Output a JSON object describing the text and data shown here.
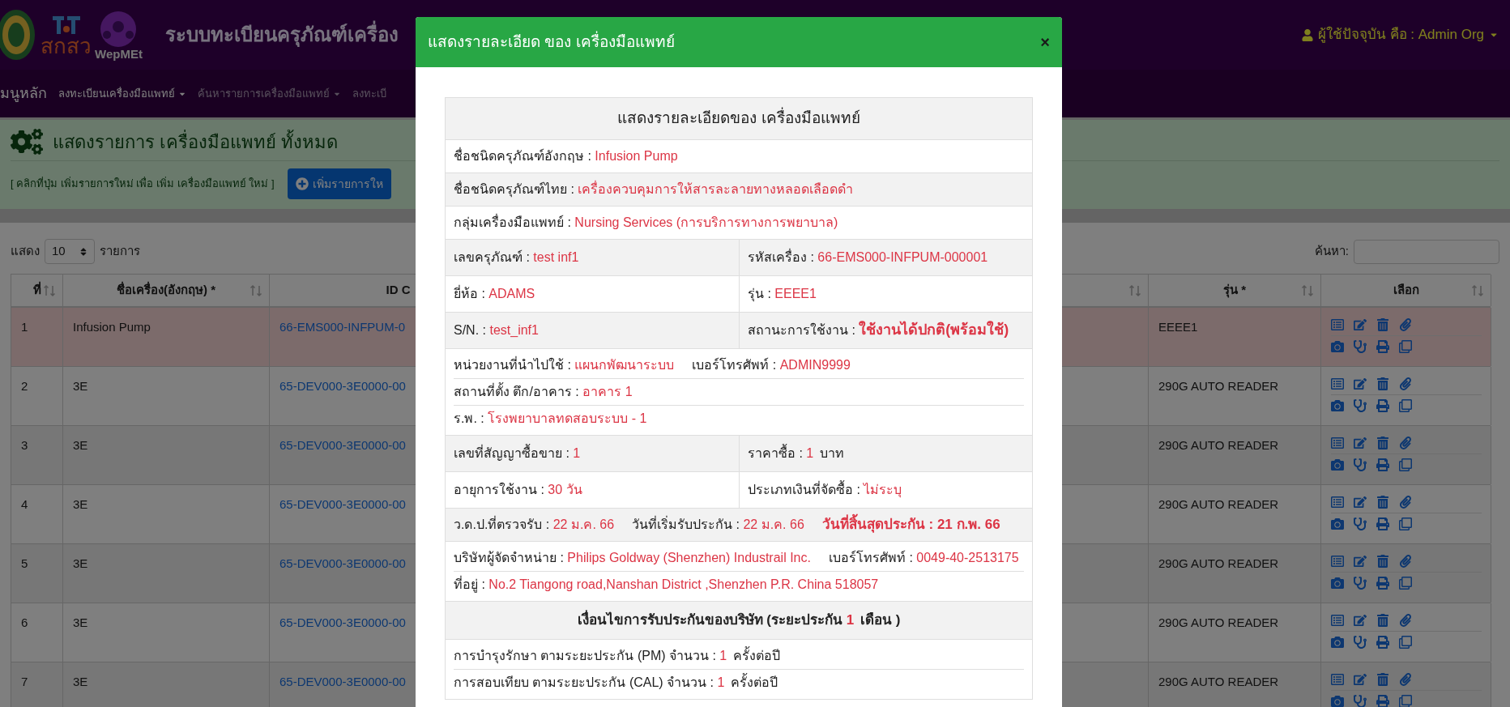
{
  "header": {
    "logo_texts": [
      "สกสว",
      "WepMEt"
    ],
    "title": "ระบบทะเบียนครุภัณฑ์เครื่อง",
    "user": "ผู้ใช้ปัจจุบัน คือ : Admin Org"
  },
  "nav": [
    {
      "label": "มนูหลัก",
      "dropdown": false,
      "dim": false
    },
    {
      "label": "ลงทะเบียนเครื่องมือแพทย์",
      "dropdown": true,
      "dim": false
    },
    {
      "label": "ค้นหารายการเครื่องมือแพทย์",
      "dropdown": true,
      "dim": true
    },
    {
      "label": "ลงทะเบี",
      "dropdown": false,
      "dim": true
    }
  ],
  "panel": {
    "title": "แสดงรายการ เครื่องมือแพทย์ ทั้งหมด",
    "hint": "[ คลิกที่ปุ่ม เพิ่มรายการใหม่ เพื่อ เพิ่ม เครื่องมือแพทย์ ใหม่ ]",
    "button": "เพิ่มรายการให"
  },
  "list_controls": {
    "show_label": "แสดง",
    "page_size": "10",
    "unit": "รายการ",
    "search_label": "ค้นหา:"
  },
  "table": {
    "columns": [
      {
        "label": "ที่",
        "sortable": true
      },
      {
        "label": "ชื่อเครื่อง(อังกฤษ) *",
        "sortable": true
      },
      {
        "label": "ID C"
      },
      {
        "sortable": true
      },
      {
        "label": "รุ่น *",
        "sortable": true
      },
      {
        "label": "เลือก",
        "sortable": true
      }
    ],
    "rows": [
      {
        "no": "1",
        "name": "Infusion Pump",
        "id": "66-EMS000-INFPUM-0",
        "model": "EEEE1",
        "selected": true
      },
      {
        "no": "2",
        "name": "3E",
        "id": "65-DEV000-3E0000-00",
        "model": "290G AUTO READER",
        "selected": false
      },
      {
        "no": "3",
        "name": "3E",
        "id": "65-DEV000-3E0000-00",
        "model": "290G AUTO READER",
        "selected": false
      },
      {
        "no": "4",
        "name": "3E",
        "id": "65-DEV000-3E0000-00",
        "model": "290G AUTO READER",
        "selected": false
      },
      {
        "no": "5",
        "name": "3E",
        "id": "65-DEV000-3E0000-00",
        "model": "290G AUTO READER",
        "selected": false
      },
      {
        "no": "6",
        "name": "3E",
        "id": "65-DEV000-3E0000-00",
        "model": "290G AUTO READER",
        "selected": false
      },
      {
        "no": "7",
        "name": "3E",
        "id": "65-DEV000-3E0000-00",
        "model": "290G AUTO READER",
        "selected": false
      }
    ]
  },
  "modal": {
    "title": "แสดงรายละเอียด ของ เครื่องมือแพทย์",
    "close": "×",
    "heading": "แสดงรายละเอียดของ เครื่องมือแพทย์",
    "rows": [
      {
        "kind": "full",
        "shaded": false,
        "lines": [
          [
            {
              "label": "ชื่อชนิดครุภัณฑ์อังกฤษ :",
              "value": "Infusion Pump"
            }
          ]
        ]
      },
      {
        "kind": "full",
        "shaded": true,
        "lines": [
          [
            {
              "label": "ชื่อชนิดครุภัณฑ์ไทย :",
              "value": "เครื่องควบคุมการให้สารละลายทางหลอดเลือดดำ"
            }
          ]
        ]
      },
      {
        "kind": "full",
        "shaded": false,
        "lines": [
          [
            {
              "label": "กลุ่มเครื่องมือแพทย์ :",
              "value": "Nursing Services (การบริการทางการพยาบาล)"
            }
          ]
        ]
      },
      {
        "kind": "split",
        "shaded": true,
        "cells": [
          {
            "label": "เลขครุภัณฑ์ :",
            "value": "test inf1"
          },
          {
            "label": "รหัสเครื่อง :",
            "value": "66-EMS000-INFPUM-000001"
          }
        ]
      },
      {
        "kind": "split",
        "shaded": false,
        "cells": [
          {
            "label": "ยี่ห้อ :",
            "value": "ADAMS"
          },
          {
            "label": "รุ่น :",
            "value": "EEEE1"
          }
        ]
      },
      {
        "kind": "split",
        "shaded": true,
        "cells": [
          {
            "label": "S/N. :",
            "value": "test_inf1"
          },
          {
            "label": "สถานะการใช้งาน :",
            "value": "ใช้งานได้ปกติ(พร้อมใช้)",
            "value_bold": true
          }
        ]
      },
      {
        "kind": "full",
        "shaded": false,
        "lines": [
          [
            {
              "label": "หน่วยงานที่นำไปใช้ :",
              "value": "แผนกพัฒนาระบบ"
            },
            {
              "label": "เบอร์โทรศัพท์ :",
              "value": "ADMIN9999"
            }
          ],
          [
            {
              "label": "สถานที่ตั้ง ตึก/อาคาร :",
              "value": "อาคาร 1"
            }
          ],
          [
            {
              "label": "ร.พ. :",
              "value": "โรงพยาบาลทดสอบระบบ - 1"
            }
          ]
        ]
      },
      {
        "kind": "split",
        "shaded": true,
        "cells": [
          {
            "label": "เลขที่สัญญาซื้อขาย :",
            "value": "1"
          },
          {
            "label": "ราคาซื้อ :",
            "value": "1",
            "suffix": "บาท"
          }
        ]
      },
      {
        "kind": "split",
        "shaded": false,
        "cells": [
          {
            "label": "อายุการใช้งาน :",
            "value": "30 วัน"
          },
          {
            "label": "ประเภทเงินที่จัดซื้อ :",
            "value": "ไม่ระบุ"
          }
        ]
      },
      {
        "kind": "full",
        "shaded": true,
        "lines": [
          [
            {
              "label": "ว.ด.ป.ที่ตรวจรับ :",
              "value": "22 ม.ค. 66"
            },
            {
              "label": "วันที่เริ่มรับประกัน :",
              "value": "22 ม.ค. 66"
            },
            {
              "label": "วันที่สิ้นสุดประกัน :",
              "value": "21 ก.พ. 66",
              "bold": true
            }
          ]
        ]
      },
      {
        "kind": "full",
        "shaded": false,
        "lines": [
          [
            {
              "label": "บริษัทผู้จัดจำหน่าย :",
              "value": "Philips Goldway (Shenzhen) Industrail Inc."
            },
            {
              "label": "เบอร์โทรศัพท์ :",
              "value": "0049-40-2513175"
            }
          ],
          [
            {
              "label": "ที่อยู่ :",
              "value": "No.2 Tiangong road,Nanshan District ,Shenzhen P.R. China 518057"
            }
          ]
        ]
      },
      {
        "kind": "section",
        "shaded": true,
        "segment": {
          "label": "เงื่อนไขการรับประกันของบริษัท (ระยะประกัน",
          "value": "1",
          "suffix": "เดือน )"
        }
      },
      {
        "kind": "full",
        "shaded": false,
        "lines": [
          [
            {
              "label": "การบำรุงรักษา ตามระยะประกัน (PM) จำนวน :",
              "value": "1",
              "suffix": "ครั้งต่อปี"
            }
          ],
          [
            {
              "label": "การสอบเทียบ ตามระยะประกัน (CAL) จำนวน :",
              "value": "1",
              "suffix": "ครั้งต่อปี"
            }
          ]
        ]
      }
    ]
  }
}
